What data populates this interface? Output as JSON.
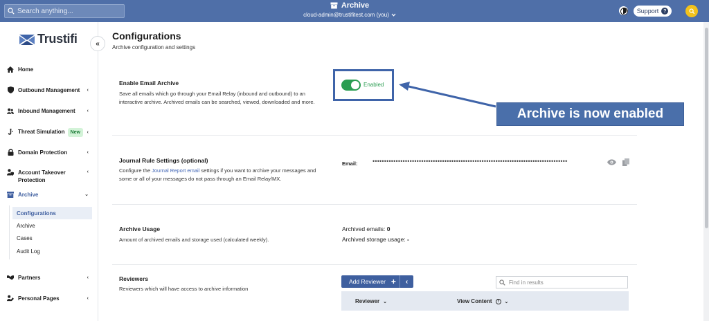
{
  "topbar": {
    "search_placeholder": "Search anything...",
    "title": "Archive",
    "user": "cloud-admin@trustifitest.com (you)",
    "support_label": "Support",
    "support_q": "?"
  },
  "sidebar": {
    "logo": "Trustifi",
    "collapse": "«",
    "items": [
      {
        "label": "Home",
        "icon": "home-icon"
      },
      {
        "label": "Outbound Management",
        "icon": "shield-icon"
      },
      {
        "label": "Inbound Management",
        "icon": "users-icon"
      },
      {
        "label": "Threat Simulation",
        "icon": "hook-icon",
        "badge": "New"
      },
      {
        "label": "Domain Protection",
        "icon": "lock-icon"
      },
      {
        "label": "Account Takeover Protection",
        "icon": "user-shield-icon"
      },
      {
        "label": "Archive",
        "icon": "archive-icon"
      },
      {
        "label": "Partners",
        "icon": "handshake-icon"
      },
      {
        "label": "Personal Pages",
        "icon": "user-edit-icon"
      }
    ],
    "archive_sub": [
      "Configurations",
      "Archive",
      "Cases",
      "Audit Log"
    ]
  },
  "page": {
    "title": "Configurations",
    "subtitle": "Archive configuration and settings"
  },
  "email_archive": {
    "title": "Enable Email Archive",
    "desc": "Save all emails which go through your Email Relay (inbound and outbound) to an interactive archive. Archived emails can be searched, viewed, downloaded and more.",
    "toggle_label": "Enabled"
  },
  "callout": "Archive is now enabled",
  "journal": {
    "title": "Journal Rule Settings (optional)",
    "desc_pre": "Configure the ",
    "desc_link": "Journal Report email",
    "desc_post": " settings if you want to archive your messages and some or all of your messages do not pass through an Email Relay/MX.",
    "email_label": "Email:",
    "email_masked": "••••••••••••••••••••••••••••••••••••••••••••••••••••••••••••••••••••••••••••••••••••••••••••••"
  },
  "usage": {
    "title": "Archive Usage",
    "desc": "Amount of archived emails and storage used (calculated weekly).",
    "emails_label": "Archived emails: ",
    "emails_value": "0",
    "storage_label": "Archived storage usage: ",
    "storage_value": "-"
  },
  "reviewers": {
    "title": "Reviewers",
    "desc": "Reviewers which will have access to archive information",
    "add_label": "Add Reviewer",
    "add_plus": "+",
    "add_chev": "‹",
    "find_placeholder": "Find in results",
    "col_reviewer": "Reviewer",
    "col_view": "View Content",
    "col_chev": "⌄"
  },
  "colors": {
    "topbar": "#4f6fa8",
    "accent": "#3f5fa0",
    "enabled_green": "#2a9d51",
    "callout": "#4a6faa"
  }
}
